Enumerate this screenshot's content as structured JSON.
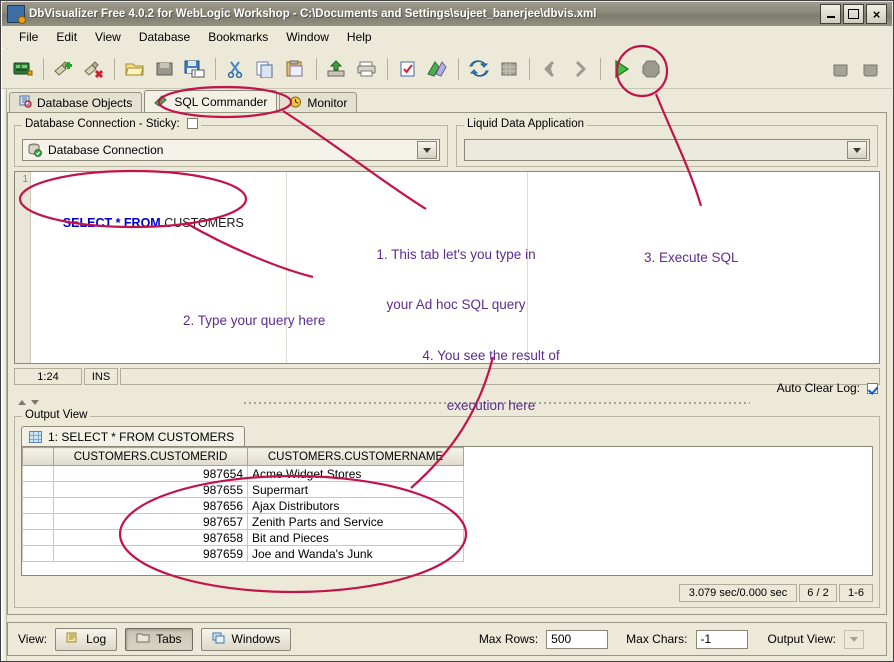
{
  "window": {
    "title": "DbVisualizer Free 4.0.2 for WebLogic Workshop - C:\\Documents and Settings\\sujeet_banerjee\\dbvis.xml",
    "minimize_label": "_",
    "maximize_label": "",
    "close_label": "×"
  },
  "menu": {
    "items": [
      {
        "label": "File"
      },
      {
        "label": "Edit"
      },
      {
        "label": "View"
      },
      {
        "label": "Database"
      },
      {
        "label": "Bookmarks"
      },
      {
        "label": "Window"
      },
      {
        "label": "Help"
      }
    ]
  },
  "toolbar": {
    "buttons": [
      {
        "name": "new-connection-icon",
        "tip": "New Database Connection"
      },
      {
        "name": "connect-icon",
        "tip": "Connect"
      },
      {
        "name": "disconnect-icon",
        "tip": "Disconnect"
      },
      {
        "name": "open-file-icon",
        "tip": "Open File"
      },
      {
        "name": "save-icon",
        "tip": "Save"
      },
      {
        "name": "save-as-icon",
        "tip": "Save As"
      },
      {
        "name": "cut-icon",
        "tip": "Cut"
      },
      {
        "name": "copy-icon",
        "tip": "Copy"
      },
      {
        "name": "paste-icon",
        "tip": "Paste"
      },
      {
        "name": "export-icon",
        "tip": "Export"
      },
      {
        "name": "print-icon",
        "tip": "Print"
      },
      {
        "name": "bookmark-check-icon",
        "tip": "Bookmarks"
      },
      {
        "name": "bookmark-add-icon",
        "tip": "Add Bookmark"
      },
      {
        "name": "refresh-icon",
        "tip": "Refresh"
      },
      {
        "name": "grid-icon",
        "tip": "Grid"
      },
      {
        "name": "previous-icon",
        "tip": "Previous"
      },
      {
        "name": "next-icon",
        "tip": "Next"
      },
      {
        "name": "execute-icon",
        "tip": "Execute SQL"
      },
      {
        "name": "stop-icon",
        "tip": "Stop"
      },
      {
        "name": "tab-left-icon",
        "tip": "Tab Left"
      },
      {
        "name": "tab-right-icon",
        "tip": "Tab Right"
      }
    ]
  },
  "tabs": [
    {
      "label": "Database Objects",
      "icon": "database-objects-icon",
      "active": false
    },
    {
      "label": "SQL Commander",
      "icon": "sql-commander-icon",
      "active": true
    },
    {
      "label": "Monitor",
      "icon": "monitor-icon",
      "active": false
    }
  ],
  "connection_panel": {
    "group_label": "Database Connection  -  Sticky:",
    "sticky_checked": false,
    "selected": "Database Connection"
  },
  "liquid_data_panel": {
    "group_label": "Liquid Data Application",
    "selected": ""
  },
  "editor": {
    "line_number": "1",
    "sql_keyword_1": "SELECT",
    "sql_star": " * ",
    "sql_keyword_2": "FROM",
    "sql_table": " CUSTOMERS",
    "status_position": "1:24",
    "status_mode": "INS"
  },
  "auto_clear_log": {
    "label": "Auto Clear Log:",
    "checked": true
  },
  "output_view": {
    "group_label": "Output View",
    "result_tab": "1: SELECT * FROM CUSTOMERS",
    "columns": [
      "CUSTOMERS.CUSTOMERID",
      "CUSTOMERS.CUSTOMERNAME"
    ],
    "rows": [
      {
        "customerid": "987654",
        "customername": "Acme Widget Stores"
      },
      {
        "customerid": "987655",
        "customername": "Supermart"
      },
      {
        "customerid": "987656",
        "customername": "Ajax Distributors"
      },
      {
        "customerid": "987657",
        "customername": "Zenith Parts and Service"
      },
      {
        "customerid": "987658",
        "customername": "Bit and Pieces"
      },
      {
        "customerid": "987659",
        "customername": "Joe and Wanda's Junk"
      }
    ],
    "status_time": "3.079 sec/0.000 sec",
    "status_counts": "6 / 2",
    "status_range": "1-6"
  },
  "bottom_bar": {
    "view_label": "View:",
    "log_button": "Log",
    "tabs_button": "Tabs",
    "windows_button": "Windows",
    "max_rows_label": "Max Rows:",
    "max_rows_value": "500",
    "max_chars_label": "Max Chars:",
    "max_chars_value": "-1",
    "output_view_label": "Output View:"
  },
  "annotations": [
    {
      "id": "a1",
      "line1": "1. This tab let's you type in",
      "line2": "your Ad hoc SQL query"
    },
    {
      "id": "a2",
      "line1": "2. Type your query here",
      "line2": ""
    },
    {
      "id": "a3",
      "line1": "3. Execute SQL",
      "line2": ""
    },
    {
      "id": "a4",
      "line1": "4. You see the result of",
      "line2": "execution here"
    }
  ],
  "colors": {
    "annotation_text": "#5b2d8e",
    "annotation_mark": "#c2134a",
    "sql_keyword": "#0000c8",
    "titlebar": "#8a8878",
    "panel": "#ece9d8"
  }
}
